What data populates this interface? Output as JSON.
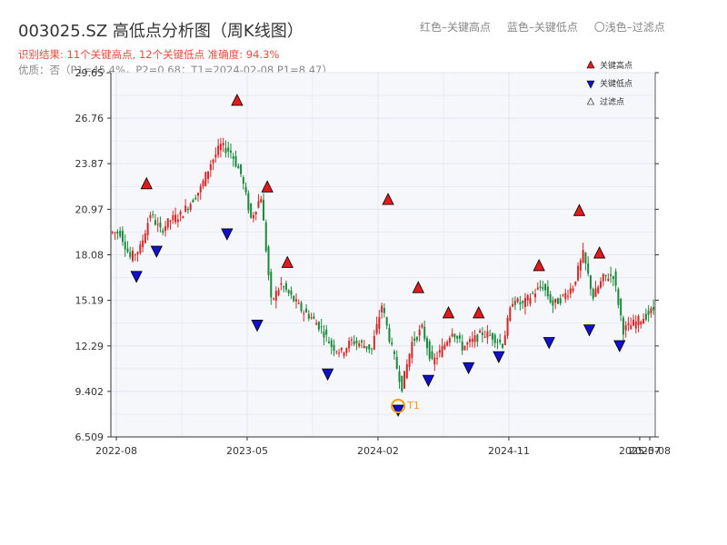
{
  "header": {
    "title": "003025.SZ 高低点分析图（周K线图）",
    "subtitle": "识别结果: 11个关键高点, 12个关键低点   准确度: 94.3%",
    "quality": "优质：否（P1=45.4%，P2=0.68；T1=2024-02-08 P1=8.47）"
  },
  "top_legend": {
    "red": "红色–关键高点",
    "blue": "蓝色–关键低点",
    "light": "〇浅色–过滤点"
  },
  "colors": {
    "up": "#d62728",
    "down": "#1a8a3a",
    "high_marker": "#e41a1c",
    "low_marker": "#1111cc",
    "t1": "#f39c12",
    "grid": "#e2e6ee",
    "plot_bg": "#f5f7fa"
  },
  "chart_data": {
    "type": "candlestick",
    "ylim": [
      6.509,
      29.65
    ],
    "yticks": [
      "6.509",
      "9.402",
      "12.29",
      "15.19",
      "18.08",
      "20.97",
      "23.87",
      "26.76",
      "29.65"
    ],
    "xticks": [
      "2022-08",
      "2023-05",
      "2024-02",
      "2024-11",
      "2025-07",
      "2025-08"
    ],
    "legend": [
      {
        "key": "high",
        "label": "关键高点"
      },
      {
        "key": "low",
        "label": "关键低点"
      },
      {
        "key": "filtered",
        "label": "过滤点"
      }
    ],
    "key_highs": [
      {
        "week": 3,
        "price": 22.1
      },
      {
        "week": 12,
        "price": 27.4
      },
      {
        "week": 15,
        "price": 21.9
      },
      {
        "week": 17,
        "price": 17.1
      },
      {
        "week": 27,
        "price": 21.1
      },
      {
        "week": 30,
        "price": 15.5
      },
      {
        "week": 33,
        "price": 13.9
      },
      {
        "week": 36,
        "price": 13.9
      },
      {
        "week": 42,
        "price": 16.9
      },
      {
        "week": 46,
        "price": 20.4
      },
      {
        "week": 48,
        "price": 17.7
      }
    ],
    "key_lows": [
      {
        "week": 2,
        "price": 17.2
      },
      {
        "week": 4,
        "price": 18.8
      },
      {
        "week": 11,
        "price": 19.9
      },
      {
        "week": 14,
        "price": 14.1
      },
      {
        "week": 21,
        "price": 11.0
      },
      {
        "week": 28,
        "price": 8.7
      },
      {
        "week": 31,
        "price": 10.6
      },
      {
        "week": 35,
        "price": 11.4
      },
      {
        "week": 38,
        "price": 12.1
      },
      {
        "week": 43,
        "price": 13.0
      },
      {
        "week": 47,
        "price": 13.8
      },
      {
        "week": 50,
        "price": 12.8
      }
    ],
    "t1": {
      "label": "T1",
      "week": 28,
      "price": 8.47
    },
    "weeks": 54,
    "close": [
      19.5,
      17.9,
      18.5,
      20.7,
      19.6,
      20.3,
      20.6,
      21.4,
      22.3,
      23.9,
      25.0,
      24.6,
      23.2,
      20.4,
      21.8,
      15.1,
      16.2,
      15.4,
      14.6,
      14.1,
      13.4,
      12.3,
      11.9,
      12.6,
      12.4,
      12.1,
      14.9,
      12.1,
      9.7,
      12.5,
      13.4,
      11.2,
      12.1,
      13.3,
      12.2,
      12.6,
      13.1,
      12.9,
      12.4,
      15.2,
      14.9,
      15.6,
      16.1,
      14.9,
      15.4,
      16.1,
      18.1,
      15.4,
      16.6,
      16.8,
      13.3,
      13.7,
      14.1,
      14.6
    ]
  }
}
